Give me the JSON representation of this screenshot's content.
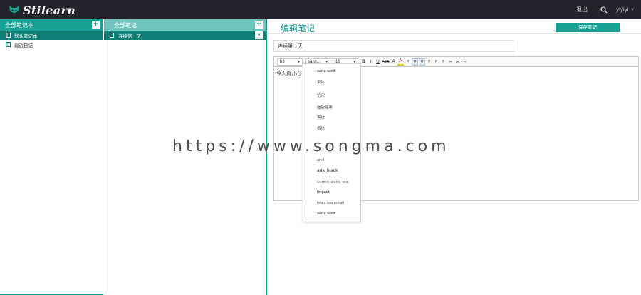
{
  "app": {
    "logo_text": "Stilearn",
    "logo_icon": "cat-face-icon",
    "accent_color": "#17a094",
    "topbar_color": "#23232b"
  },
  "topbar": {
    "logout_label": "退出",
    "search_icon": "search-icon",
    "username": "yiyiyi",
    "user_caret": "˅"
  },
  "notebooks": {
    "header": "全部笔记本",
    "add_label": "+",
    "items": [
      {
        "label": "默认笔记本",
        "active": true
      },
      {
        "label": "最近日记",
        "active": false
      }
    ]
  },
  "notes": {
    "header": "全部笔记",
    "add_label": "+",
    "items": [
      {
        "label": "连续第一天",
        "active": true
      }
    ],
    "collapse_label": "˅"
  },
  "editor": {
    "heading": "编辑笔记",
    "save_label": "保存笔记",
    "title_value": "连续第一天",
    "body_text": "今天真开心",
    "toolbar": {
      "block_format": "h3",
      "font_family": "sans…",
      "font_size": "16",
      "buttons": [
        "B",
        "I",
        "U",
        "ABC",
        "A",
        "A",
        "≡",
        "≡",
        "≡",
        "≡",
        "≡",
        "≡",
        "∞",
        "✂",
        "↔"
      ]
    },
    "font_dropdown": {
      "options": [
        "sans serif",
        "宋体",
        "",
        "仿宋",
        "微软雅黑",
        "黑体",
        "楷体",
        "",
        "",
        "arial",
        "arial black",
        "comic sans ms",
        "impact",
        "times new roman",
        "sans serif"
      ]
    }
  },
  "watermark": "https://www.songma.com"
}
